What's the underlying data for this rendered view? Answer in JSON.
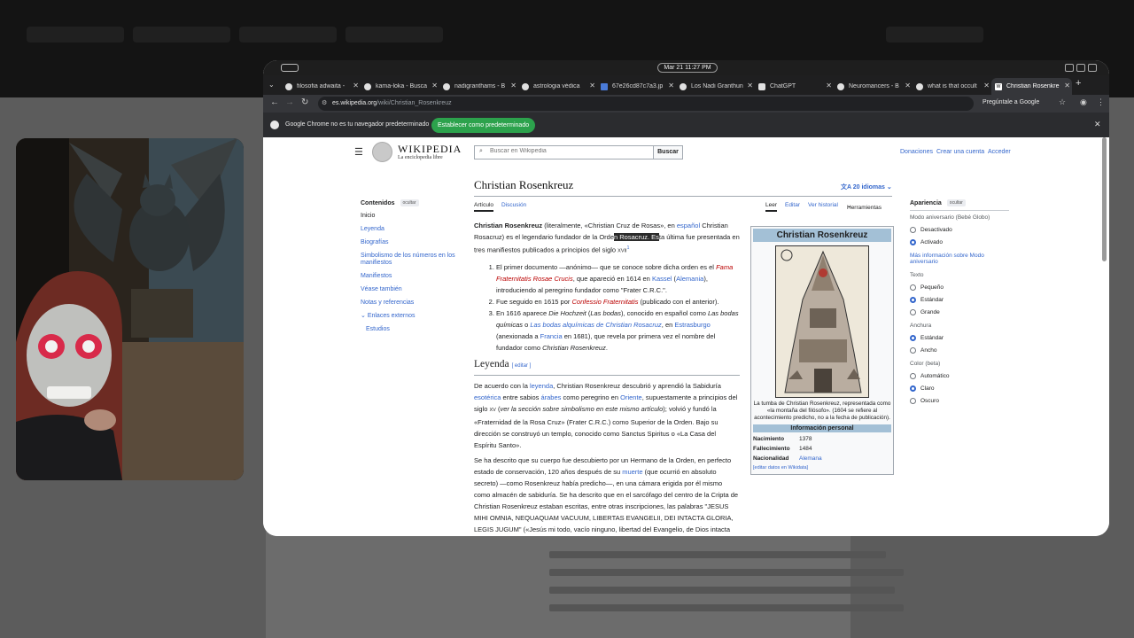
{
  "system": {
    "clock": "Mar 21  11:27 PM"
  },
  "tabs": [
    {
      "label": "filosofia adwaita -",
      "active": false
    },
    {
      "label": "kama-loka - Busca",
      "active": false
    },
    {
      "label": "nadigranthams - B",
      "active": false
    },
    {
      "label": "astrologia védica",
      "active": false
    },
    {
      "label": "67e26cd87c7a3.jp",
      "active": false
    },
    {
      "label": "Los Nadi Granthun",
      "active": false
    },
    {
      "label": "ChatGPT",
      "active": false
    },
    {
      "label": "Neuromancers - B",
      "active": false
    },
    {
      "label": "what is that occult",
      "active": false
    },
    {
      "label": "Christian Rosenkre",
      "active": true
    }
  ],
  "toolbar": {
    "url_host": "es.wikipedia.org",
    "url_path": "/wiki/Christian_Rosenkreuz",
    "ask_google": "Pregúntale a Google"
  },
  "infobar": {
    "message": "Google Chrome no es tu navegador predeterminado",
    "button": "Establecer como predeterminado"
  },
  "wiki_header": {
    "logo_title": "WIKIPEDIA",
    "logo_subtitle": "La enciclopedia libre",
    "search_placeholder": "Buscar en Wikipedia",
    "search_button": "Buscar",
    "links": [
      "Donaciones",
      "Crear una cuenta",
      "Acceder"
    ]
  },
  "toc": {
    "title": "Contenidos",
    "hide": "ocultar",
    "items": [
      "Inicio",
      "Leyenda",
      "Biografías",
      "Simbolismo de los números en los manifiestos",
      "Manifiestos",
      "Véase también",
      "Notas y referencias",
      "Enlaces externos",
      "Estudios"
    ]
  },
  "article": {
    "title": "Christian Rosenkreuz",
    "languages": "20 idiomas",
    "tabs": {
      "article": "Artículo",
      "talk": "Discusión",
      "read": "Leer",
      "edit": "Editar",
      "history": "Ver historial",
      "tools": "Herramientas"
    },
    "intro": {
      "name": "Christian Rosenkreuz",
      "t1": " (literalmente, «Christian Cruz de Rosas», en ",
      "l1": "español",
      "t2": " Christian Rosacruz) es el legendario fundador de la Orde",
      "hl": "n Rosacruz. Es",
      "t3": "ta última fue presentada en tres manifiestos publicados a principios del siglo ",
      "century": "XVII",
      "ref": "1"
    },
    "list": {
      "i1_a": "El primer documento —anónimo— que se conoce sobre dicha orden es el ",
      "i1_b": "Fama Fraternitatis Rosae Crucis",
      "i1_c": ", que apareció en 1614 en ",
      "i1_d": "Kassel",
      "i1_e": " (",
      "i1_f": "Alemania",
      "i1_g": "), introduciendo al peregrino fundador como \"Frater C.R.C.\".",
      "i2_a": "Fue seguido en 1615 por ",
      "i2_b": "Confessio Fraternitatis",
      "i2_c": " (publicado con el anterior).",
      "i3_a": "En 1616 aparece ",
      "i3_b": "Die Hochzeit",
      "i3_c": " (",
      "i3_d": "Las bodas",
      "i3_e": "), conocido en español como ",
      "i3_f": "Las bodas químicas",
      "i3_g": " o ",
      "i3_h": "Las bodas alquímicas de Christian Rosacruz",
      "i3_i": ", en ",
      "i3_j": "Estrasburgo",
      "i3_k": " (anexionada a ",
      "i3_l": "Francia",
      "i3_m": " en 1681), que revela por primera vez el nombre del fundador como ",
      "i3_n": "Christian Rosenkreuz",
      "i3_o": "."
    },
    "leyenda_heading": "Leyenda",
    "edit_label": "[ editar ]",
    "p2": {
      "a": "De acuerdo con la ",
      "b": "leyenda",
      "c": ", Christian Rosenkreuz descubrió y aprendió la Sabiduría ",
      "d": "esotérica",
      "e": " entre sabios ",
      "f": "árabes",
      "g": " como peregrino en ",
      "h": "Oriente",
      "i": ", supuestamente a principios del siglo ",
      "j": "XV",
      "k": " (",
      "l": "ver la sección sobre simbolismo en este mismo artículo",
      "m": "); volvió y fundó la «Fraternidad de la Rosa Cruz» (Frater C.R.C.) como Superior de la Orden. Bajo su dirección se construyó un templo, conocido como Sanctus Spiritus o «La Casa del Espíritu Santo»."
    },
    "p3": {
      "a": "Se ha descrito que su cuerpo fue descubierto por un Hermano de la Orden, en perfecto estado de conservación, 120 años después de su ",
      "b": "muerte",
      "c": " (que ocurrió en absoluto secreto) —como Rosenkreuz había predicho—, en una cámara erigida por él mismo como almacén de sabiduría. Se ha descrito que en el sarcófago del centro de la Cripta de Christian Rosenkreuz estaban escritas, entre otras inscripciones, las palabras \"JESUS MIHI OMNIA, NEQUAQUAM VACUUM, LIBERTAS EVANGELII, DEI INTACTA GLORIA, LEGIS JUGUM\" («Jesús mi todo, vacío ninguno, libertad del Evangelio, de Dios intacta"
    }
  },
  "infobox": {
    "title": "Christian Rosenkreuz",
    "caption": "La tumba de Christian Rosenkreuz, representada como «la montaña del filósofo». (1604 se refiere al acontecimiento predicho, no a la fecha de publicación).",
    "section": "Información personal",
    "rows": [
      {
        "k": "Nacimiento",
        "v": "1378"
      },
      {
        "k": "Fallecimiento",
        "v": "1484"
      },
      {
        "k": "Nacionalidad",
        "v": "Alemana"
      }
    ],
    "edit_wikidata": "[editar datos en Wikidata]"
  },
  "appearance": {
    "title": "Apariencia",
    "hide": "ocultar",
    "anniversary_label": "Modo aniversario (Bebé Globo)",
    "anniversary_options": [
      "Desactivado",
      "Activado"
    ],
    "anniversary_selected": 1,
    "more_info": "Más información sobre Modo aniversario",
    "text_label": "Texto",
    "text_options": [
      "Pequeño",
      "Estándar",
      "Grande"
    ],
    "text_selected": 1,
    "width_label": "Anchura",
    "width_options": [
      "Estándar",
      "Ancho"
    ],
    "width_selected": 0,
    "color_label": "Color (beta)",
    "color_options": [
      "Automático",
      "Claro",
      "Oscuro"
    ],
    "color_selected": 1
  },
  "colors": {
    "link": "#3366cc",
    "red_link": "#ba0000",
    "infobox_header": "#a3c0d6",
    "chrome_dark": "#35363a",
    "green_button": "#2ca24c"
  }
}
